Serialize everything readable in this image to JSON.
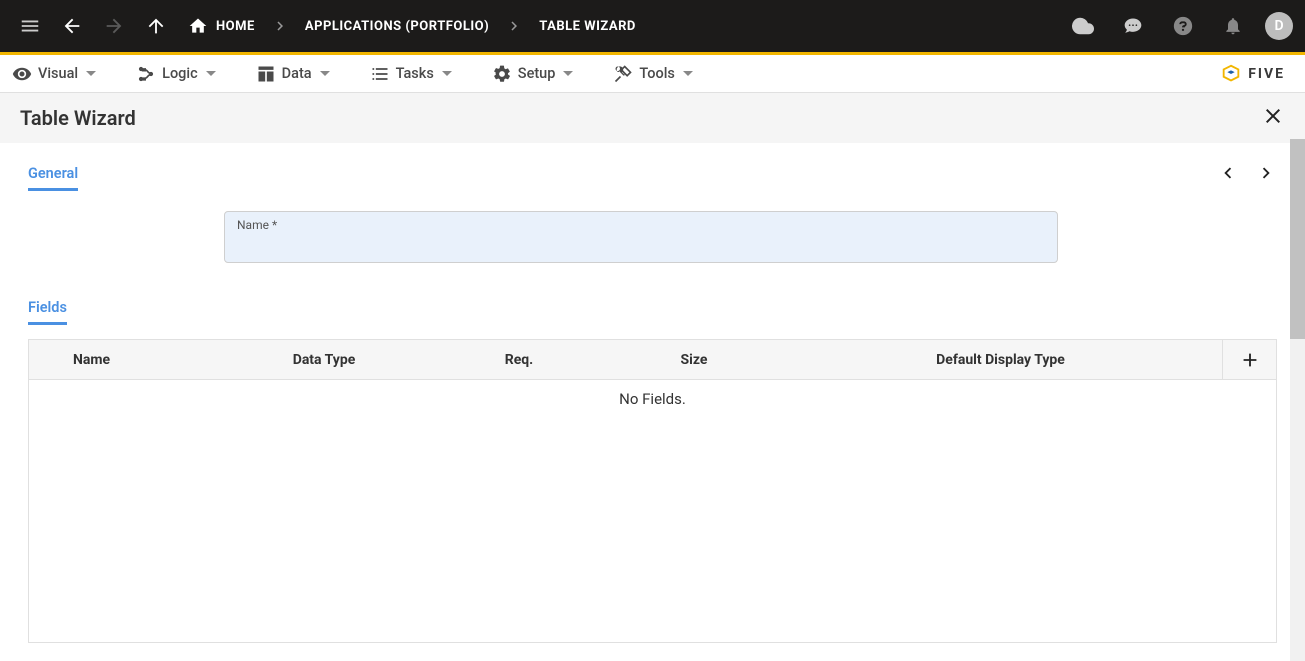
{
  "breadcrumb": {
    "home": "HOME",
    "apps": "APPLICATIONS (PORTFOLIO)",
    "wizard": "TABLE WIZARD"
  },
  "user": {
    "initial": "D"
  },
  "menu": {
    "visual": "Visual",
    "logic": "Logic",
    "data": "Data",
    "tasks": "Tasks",
    "setup": "Setup",
    "tools": "Tools"
  },
  "brand": "FIVE",
  "panel": {
    "title": "Table Wizard"
  },
  "tabs": {
    "general": "General",
    "fields": "Fields"
  },
  "form": {
    "name_label": "Name *",
    "name_value": ""
  },
  "grid": {
    "col_name": "Name",
    "col_type": "Data Type",
    "col_req": "Req.",
    "col_size": "Size",
    "col_def": "Default Display Type",
    "empty": "No Fields."
  }
}
